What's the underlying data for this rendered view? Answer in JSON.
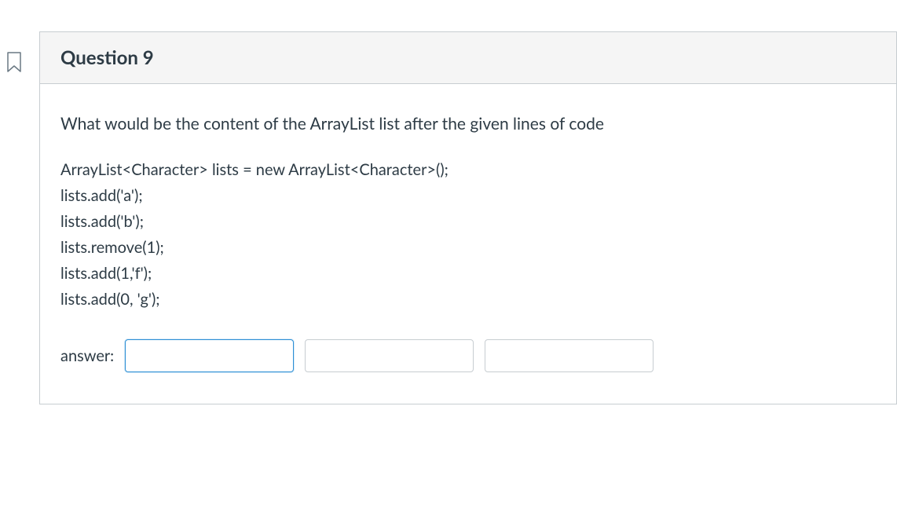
{
  "question": {
    "title": "Question 9",
    "prompt": "What would be the content of the ArrayList  list after the given lines of code",
    "code": [
      "ArrayList<Character> lists = new ArrayList<Character>();",
      "lists.add('a');",
      "lists.add('b');",
      "lists.remove(1);",
      "lists.add(1,'f');",
      "lists.add(0, 'g');"
    ],
    "answer_label": "answer:",
    "inputs": {
      "field1": "",
      "field2": "",
      "field3": ""
    }
  }
}
